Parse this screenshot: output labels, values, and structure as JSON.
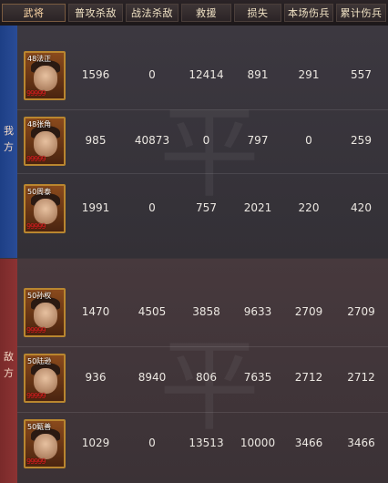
{
  "headers": [
    "武将",
    "普攻杀敌",
    "战法杀敌",
    "救援",
    "损失",
    "本场伤兵",
    "累计伤兵"
  ],
  "own_side": {
    "label_chars": [
      "我",
      "方"
    ],
    "watermark": "平"
  },
  "enemy_side": {
    "label_chars": [
      "敌",
      "方"
    ],
    "watermark": "平"
  },
  "own_rows": [
    {
      "level_name": "48法正",
      "stars": "99999",
      "values": [
        "1596",
        "0",
        "12414",
        "891",
        "291",
        "557"
      ]
    },
    {
      "level_name": "48张角",
      "stars": "99999",
      "values": [
        "985",
        "40873",
        "0",
        "797",
        "0",
        "259"
      ]
    },
    {
      "level_name": "50周泰",
      "stars": "99999",
      "values": [
        "1991",
        "0",
        "757",
        "2021",
        "220",
        "420"
      ]
    }
  ],
  "enemy_rows": [
    {
      "level_name": "50孙权",
      "stars": "99999",
      "values": [
        "1470",
        "4505",
        "3858",
        "9633",
        "2709",
        "2709"
      ]
    },
    {
      "level_name": "50陆逊",
      "stars": "99999",
      "values": [
        "936",
        "8940",
        "806",
        "7635",
        "2712",
        "2712"
      ]
    },
    {
      "level_name": "50甄善",
      "stars": "99999",
      "values": [
        "1029",
        "0",
        "13513",
        "10000",
        "3466",
        "3466"
      ]
    }
  ],
  "colors": {
    "own_side": "#2a4c96",
    "enemy_side": "#8c3333",
    "star_red": "#d22222",
    "portrait_border": "#b9862f"
  }
}
